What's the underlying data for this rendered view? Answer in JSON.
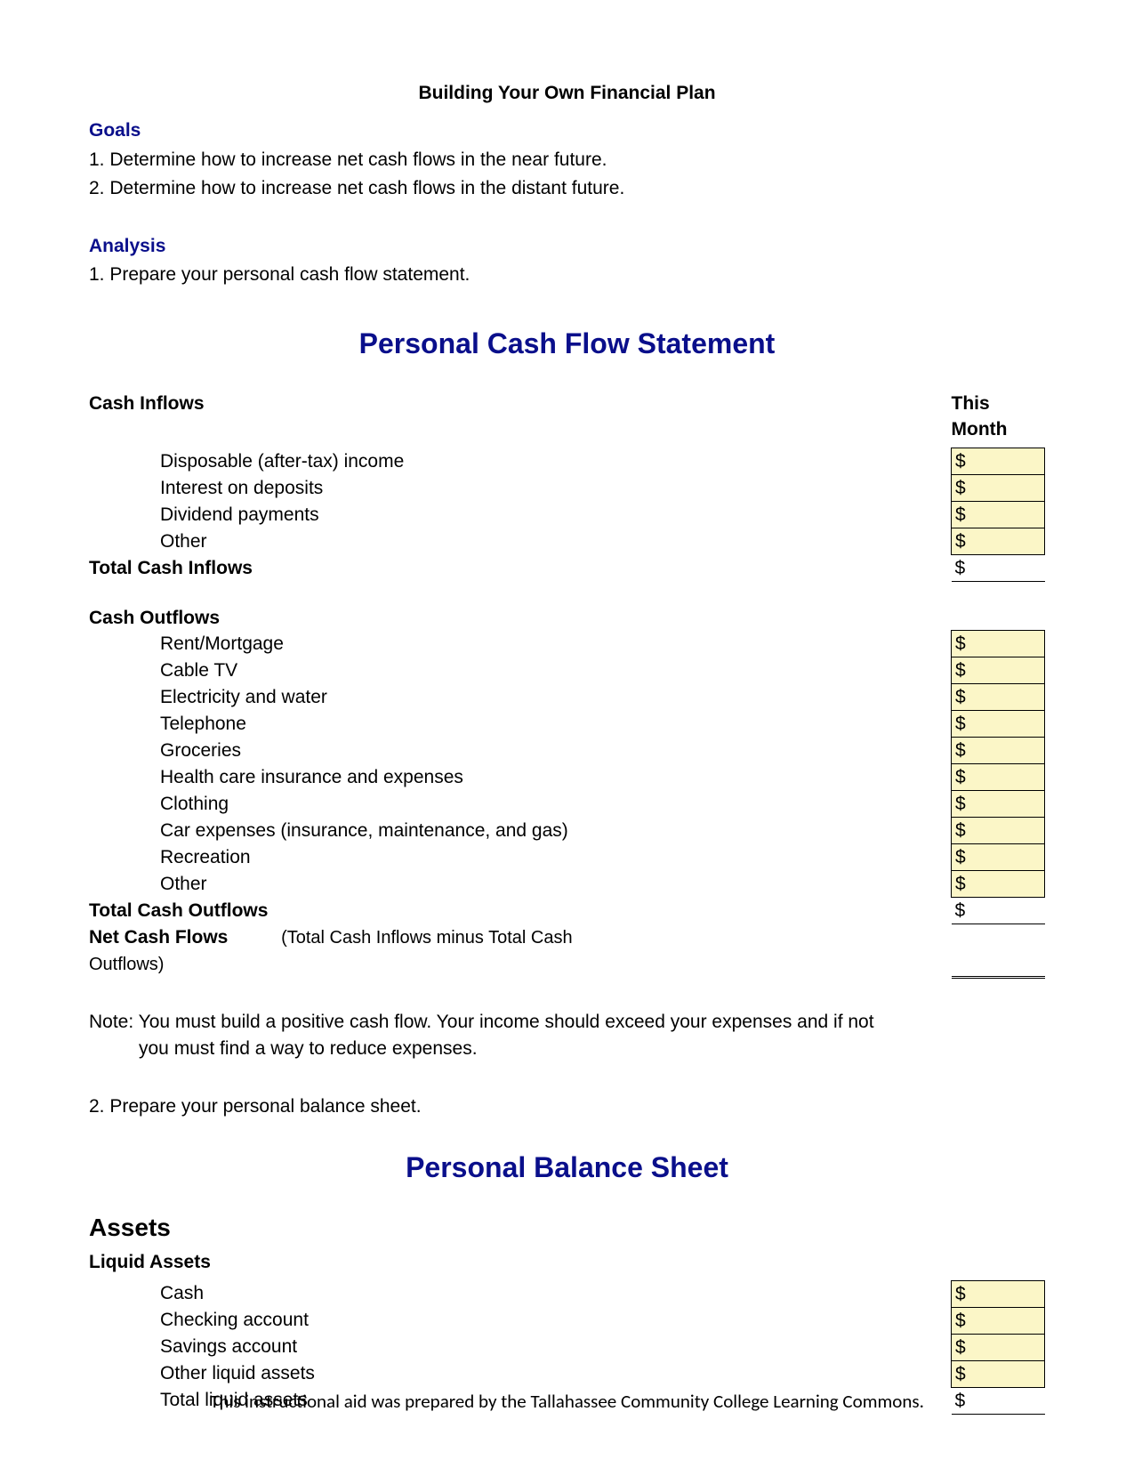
{
  "doc_title": "Building Your Own Financial Plan",
  "goals_header": "Goals",
  "goals": [
    "1. Determine how to increase net cash flows in the near future.",
    "2. Determine how to increase net cash flows in the distant future."
  ],
  "analysis_header": "Analysis",
  "analysis_step1": "1. Prepare your personal cash flow statement.",
  "cashflow_title": "Personal Cash Flow Statement",
  "col_this_month": "This Month",
  "dollar": "$",
  "inflows_header": "Cash Inflows",
  "inflows": [
    "Disposable (after-tax) income",
    "Interest on deposits",
    "Dividend payments",
    "Other"
  ],
  "total_inflows_label": "Total Cash Inflows",
  "outflows_header": "Cash Outflows",
  "outflows": [
    "Rent/Mortgage",
    "Cable TV",
    "Electricity and water",
    "Telephone",
    "Groceries",
    "Health care insurance and expenses",
    "Clothing",
    "Car expenses (insurance, maintenance, and gas)",
    "Recreation",
    "Other"
  ],
  "total_outflows_label": "Total Cash Outflows",
  "net_label": "Net Cash Flows",
  "net_sub": "(Total Cash Inflows minus Total Cash Outflows)",
  "note_line1": "Note: You must build a positive cash flow.  Your income should exceed your expenses and if not",
  "note_line2": "you must find a way to reduce expenses.",
  "analysis_step2": "2. Prepare your personal balance sheet.",
  "balance_title": "Personal Balance Sheet",
  "assets_header": "Assets",
  "liquid_header": "Liquid Assets",
  "liquid_assets": [
    "Cash",
    "Checking account",
    "Savings account",
    "Other liquid assets"
  ],
  "total_liquid_label": "Total liquid assets",
  "footer": "This instructional aid was prepared by the Tallahassee Community College Learning Commons."
}
